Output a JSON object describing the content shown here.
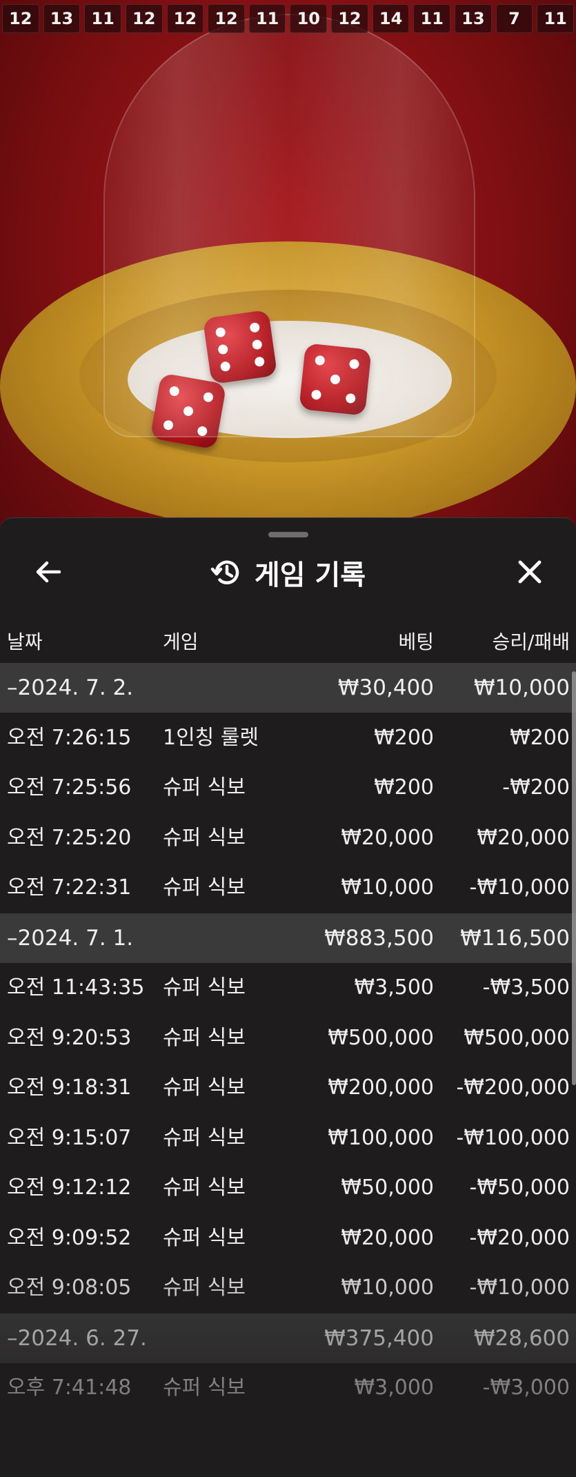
{
  "history_numbers": [
    "12",
    "13",
    "11",
    "12",
    "12",
    "12",
    "11",
    "10",
    "12",
    "14",
    "11",
    "13",
    "7",
    "11"
  ],
  "colors": {
    "sheet_bg": "#1e1c1d",
    "date_row_bg": "#3b3a3a",
    "scene_red": "#a8171b",
    "gold": "#c79426"
  },
  "sheet": {
    "title": "게임 기록",
    "icons": {
      "back": "arrow-left-icon",
      "history": "history-clock-icon",
      "close": "close-x-icon"
    }
  },
  "columns": {
    "date": "날짜",
    "game": "게임",
    "bet": "베팅",
    "win_loss": "승리/패배"
  },
  "groups": [
    {
      "date": "–2024. 7. 2.",
      "bet": "₩30,400",
      "win": "₩10,000",
      "rows": [
        {
          "time": "오전 7:26:15",
          "game": "1인칭 룰렛",
          "bet": "₩200",
          "win": "₩200"
        },
        {
          "time": "오전 7:25:56",
          "game": "슈퍼 식보",
          "bet": "₩200",
          "win": "-₩200"
        },
        {
          "time": "오전 7:25:20",
          "game": "슈퍼 식보",
          "bet": "₩20,000",
          "win": "₩20,000"
        },
        {
          "time": "오전 7:22:31",
          "game": "슈퍼 식보",
          "bet": "₩10,000",
          "win": "-₩10,000"
        }
      ]
    },
    {
      "date": "–2024. 7. 1.",
      "bet": "₩883,500",
      "win": "₩116,500",
      "rows": [
        {
          "time": "오전 11:43:35",
          "game": "슈퍼 식보",
          "bet": "₩3,500",
          "win": "-₩3,500"
        },
        {
          "time": "오전 9:20:53",
          "game": "슈퍼 식보",
          "bet": "₩500,000",
          "win": "₩500,000"
        },
        {
          "time": "오전 9:18:31",
          "game": "슈퍼 식보",
          "bet": "₩200,000",
          "win": "-₩200,000"
        },
        {
          "time": "오전 9:15:07",
          "game": "슈퍼 식보",
          "bet": "₩100,000",
          "win": "-₩100,000"
        },
        {
          "time": "오전 9:12:12",
          "game": "슈퍼 식보",
          "bet": "₩50,000",
          "win": "-₩50,000"
        },
        {
          "time": "오전 9:09:52",
          "game": "슈퍼 식보",
          "bet": "₩20,000",
          "win": "-₩20,000"
        },
        {
          "time": "오전 9:08:05",
          "game": "슈퍼 식보",
          "bet": "₩10,000",
          "win": "-₩10,000"
        }
      ]
    },
    {
      "date": "–2024. 6. 27.",
      "bet": "₩375,400",
      "win": "₩28,600",
      "rows": [
        {
          "time": "오후 7:41:48",
          "game": "슈퍼 식보",
          "bet": "₩3,000",
          "win": "-₩3,000"
        }
      ]
    }
  ]
}
